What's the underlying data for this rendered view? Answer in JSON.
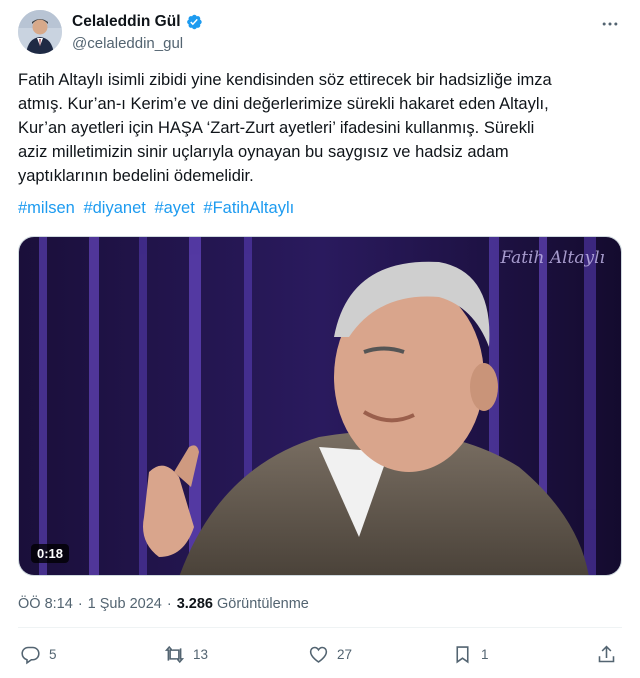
{
  "author": {
    "display_name": "Celaleddin Gül",
    "handle": "@celaleddin_gul"
  },
  "tweet": {
    "text": "Fatih Altaylı isimli zibidi yine kendisinden söz ettirecek bir hadsizliğe imza\natmış. Kur’an-ı Kerim’e ve dini değerlerimize sürekli hakaret eden Altaylı,\nKur’an ayetleri için HAŞA ‘Zart-Zurt ayetleri’ ifadesini kullanmış. Sürekli\naziz milletimizin sinir uçlarıyla oynayan bu saygısız ve hadsiz adam\nyaptıklarının bedelini ödemelidir.",
    "hashtags": [
      "#milsen",
      "#diyanet",
      "#ayet",
      "#FatihAltaylı"
    ]
  },
  "media": {
    "watermark": "Fatih Altaylı",
    "duration": "0:18"
  },
  "meta": {
    "time": "ÖÖ 8:14",
    "separator": "·",
    "date": "1 Şub 2024",
    "views_count": "3.286",
    "views_label": "Görüntülenme"
  },
  "actions": {
    "replies": "5",
    "retweets": "13",
    "likes": "27",
    "bookmarks": "1"
  },
  "colors": {
    "accent": "#1d9bf0",
    "secondary_text": "#536471",
    "primary_text": "#0f1419"
  },
  "icons": {
    "verified": "verified-badge-icon",
    "more": "more-dots-icon",
    "reply": "reply-icon",
    "retweet": "retweet-icon",
    "like": "heart-icon",
    "bookmark": "bookmark-icon",
    "share": "share-icon"
  }
}
